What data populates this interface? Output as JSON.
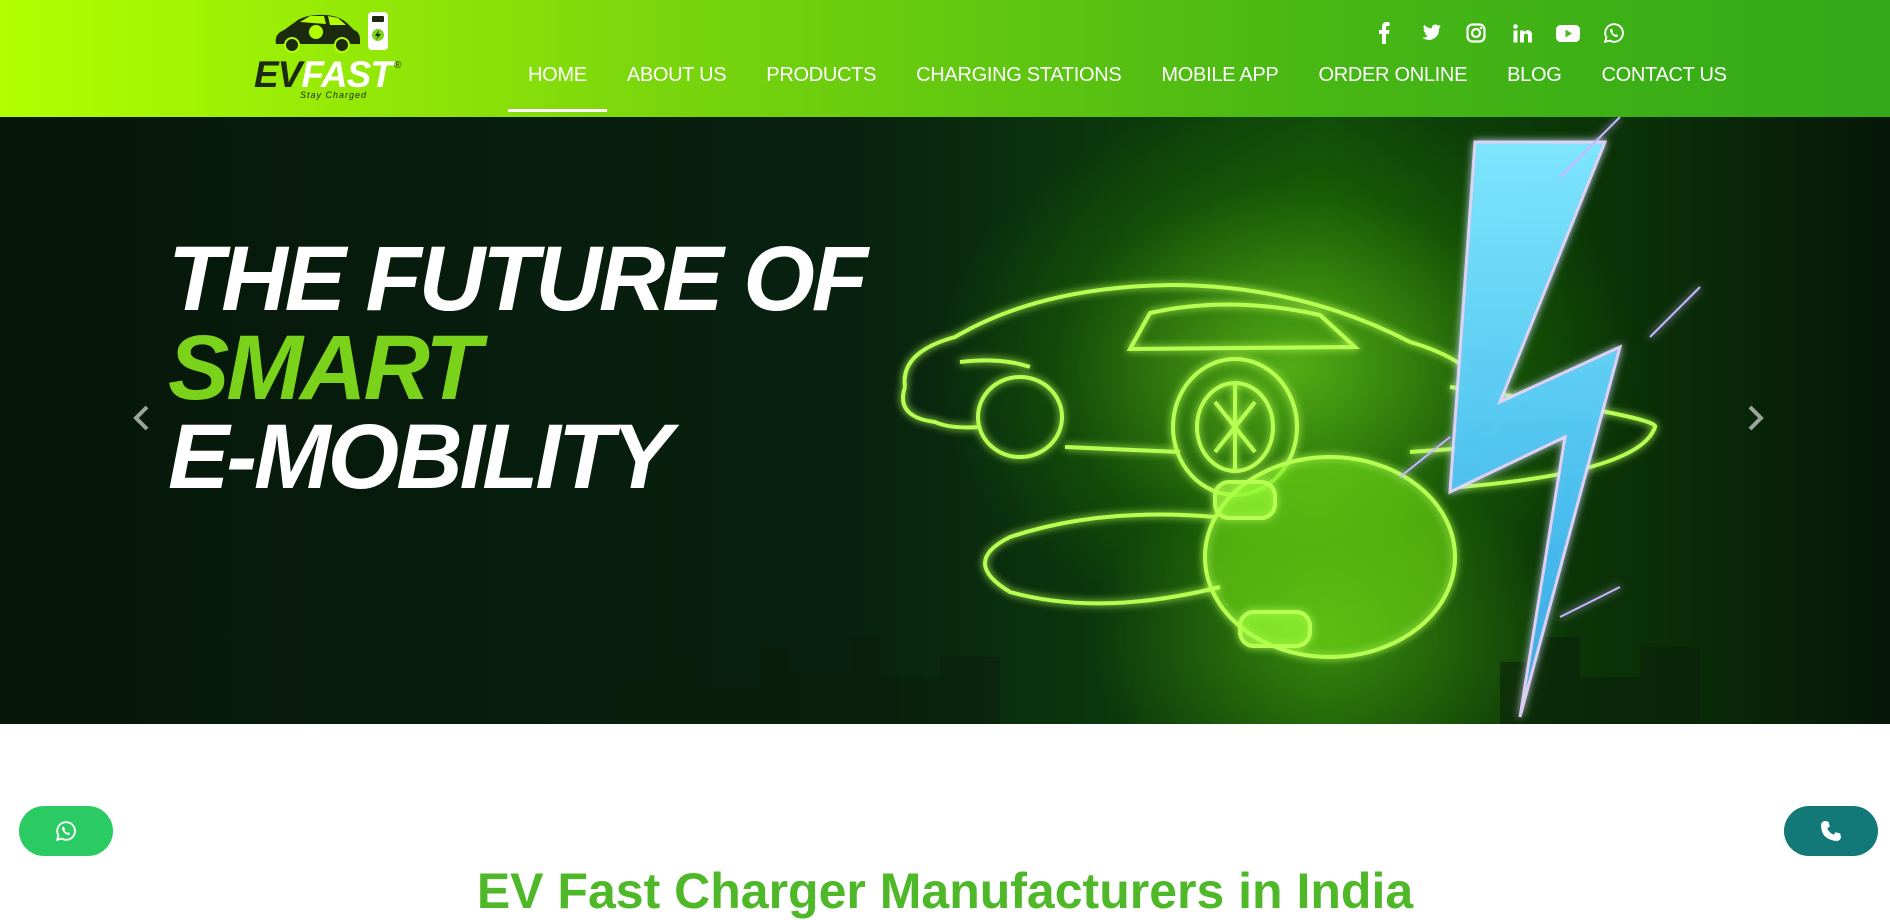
{
  "brand": {
    "name_ev": "EV",
    "name_fast": "FAST",
    "registered": "®",
    "tagline": "Stay Charged"
  },
  "social": [
    {
      "name": "facebook-icon"
    },
    {
      "name": "twitter-icon"
    },
    {
      "name": "instagram-icon"
    },
    {
      "name": "linkedin-icon"
    },
    {
      "name": "youtube-icon"
    },
    {
      "name": "whatsapp-icon"
    }
  ],
  "nav": {
    "items": [
      {
        "label": "HOME",
        "active": true
      },
      {
        "label": "ABOUT US"
      },
      {
        "label": "PRODUCTS"
      },
      {
        "label": "CHARGING STATIONS"
      },
      {
        "label": "MOBILE APP"
      },
      {
        "label": "ORDER ONLINE"
      },
      {
        "label": "BLOG"
      },
      {
        "label": "CONTACT US"
      }
    ]
  },
  "hero": {
    "line1": "THE FUTURE OF",
    "line2": "SMART",
    "line3": "E-MOBILITY"
  },
  "section": {
    "title": "EV Fast Charger Manufacturers in India"
  },
  "colors": {
    "accent_green": "#7bd21a",
    "title_green": "#4fb829",
    "whatsapp_green": "#2bcb63",
    "call_teal": "#127878"
  }
}
